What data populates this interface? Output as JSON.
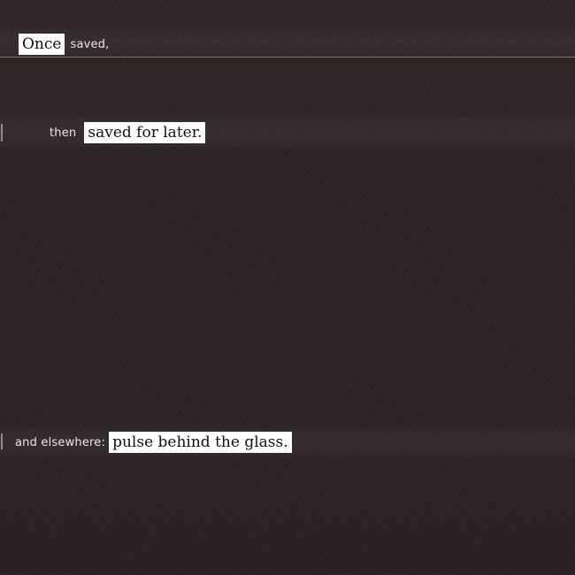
{
  "background_color": "#2d2525",
  "clipping_color": "#ffffff",
  "lines": [
    {
      "clipping": "Once",
      "note": "saved,"
    },
    {
      "note": "then",
      "clipping": "saved for later."
    },
    {
      "note": "and elsewhere:",
      "clipping": "pulse behind the glass."
    }
  ]
}
